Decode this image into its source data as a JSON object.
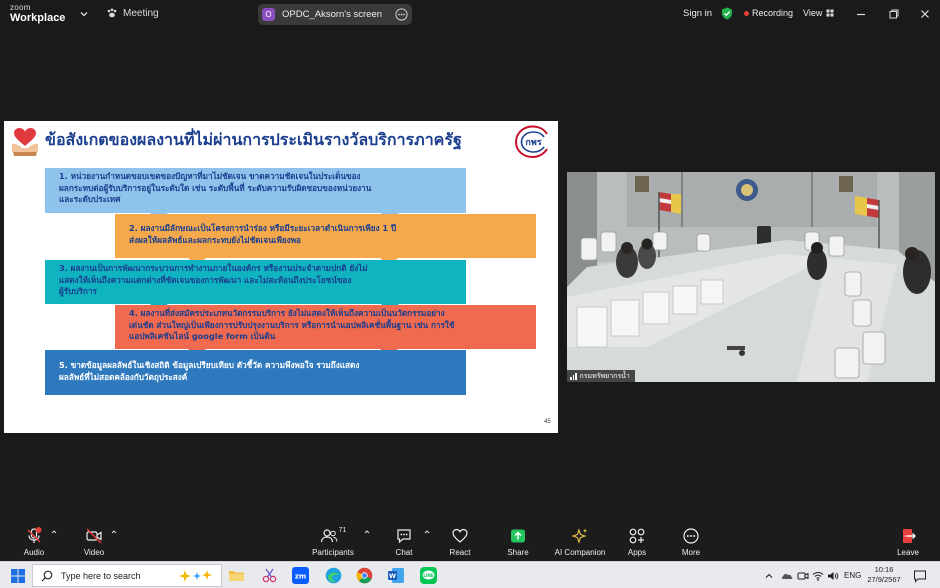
{
  "titlebar": {
    "brand_top": "zoom",
    "brand_bottom": "Workplace",
    "meeting_label": "Meeting",
    "share_avatar": "O",
    "share_title": "OPDC_Aksorn's screen",
    "signin_label": "Sign in",
    "recording_label": "Recording",
    "view_label": "View",
    "colors": {
      "recording_dot": "#e8413b",
      "shield": "#22b14c",
      "avatar": "#8a4ebf"
    }
  },
  "slide": {
    "title": "ข้อสังเกตของผลงานที่ไม่ผ่านการประเมินรางวัลบริการภาครัฐ",
    "logo_text": "กพร",
    "page_number": "45",
    "boxes": [
      {
        "lines": [
          "1. หน่วยงานกำหนดขอบเขตของปัญหาที่มาไม่ชัดเจน ขาดความชัดเจนในประเด็นของ",
          "ผลกระทบต่อผู้รับบริการอยู่ในระดับใด เช่น ระดับพื้นที่ ระดับความรับผิดชอบของหน่วยงาน",
          "และระดับประเทศ"
        ],
        "color": "#8ec4ec"
      },
      {
        "lines": [
          "2. ผลงานมีลักษณะเป็นโครงการนำร่อง หรือมีระยะเวลาดำเนินการเพียง 1 ปี",
          "ส่งผลให้ผลลัพธ์และผลกระทบยังไม่ชัดเจนเพียงพอ"
        ],
        "color": "#f6a94b"
      },
      {
        "lines": [
          "3. ผลงานเป็นการพัฒนากระบวนการทำงานภายในองค์กร หรืองานประจำตามปกติ ยังไม่",
          "แสดงให้เห็นถึงความแตกต่างที่ชัดเจนของการพัฒนา และไม่สะท้อนถึงประโยชน์ของ",
          "ผู้รับบริการ"
        ],
        "color": "#10b4c0"
      },
      {
        "lines": [
          "4. ผลงานที่ส่งสมัครประเภทนวัตกรรมบริการ ยังไม่แสดงให้เห็นถึงความเป็นนวัตกรรมอย่าง",
          "เด่นชัด ส่วนใหญ่เป็นเพียงการปรับปรุงงานบริการ หรือการนำแอปพลิเคชั่นพื้นฐาน เช่น การใช้",
          "แอปพลิเคชันไลน์ google form เป็นต้น"
        ],
        "color": "#ef6a4f"
      },
      {
        "lines": [
          "5. ขาดข้อมูลผลลัพธ์ในเชิงสถิติ ข้อมูลเปรียบเทียบ ตัวชี้วัด ความพึงพอใจ รวมถึงแสดง",
          "ผลลัพธ์ที่ไม่สอดคล้องกับวัตถุประสงค์"
        ],
        "color": "#2e78be"
      }
    ]
  },
  "video": {
    "participant_name": "กรมทรัพยากรน้ำ"
  },
  "toolbar": {
    "audio": "Audio",
    "video": "Video",
    "participants": "Participants",
    "participants_count": "71",
    "chat": "Chat",
    "react": "React",
    "share": "Share",
    "ai_companion": "AI Companion",
    "apps": "Apps",
    "more": "More",
    "leave": "Leave",
    "colors": {
      "share": "#22c55e",
      "mute": "#e8413b",
      "leave": "#e8413b"
    }
  },
  "taskbar": {
    "search_placeholder": "Type here to search",
    "language": "ENG",
    "time": "10:16",
    "date": "27/9/2567"
  }
}
